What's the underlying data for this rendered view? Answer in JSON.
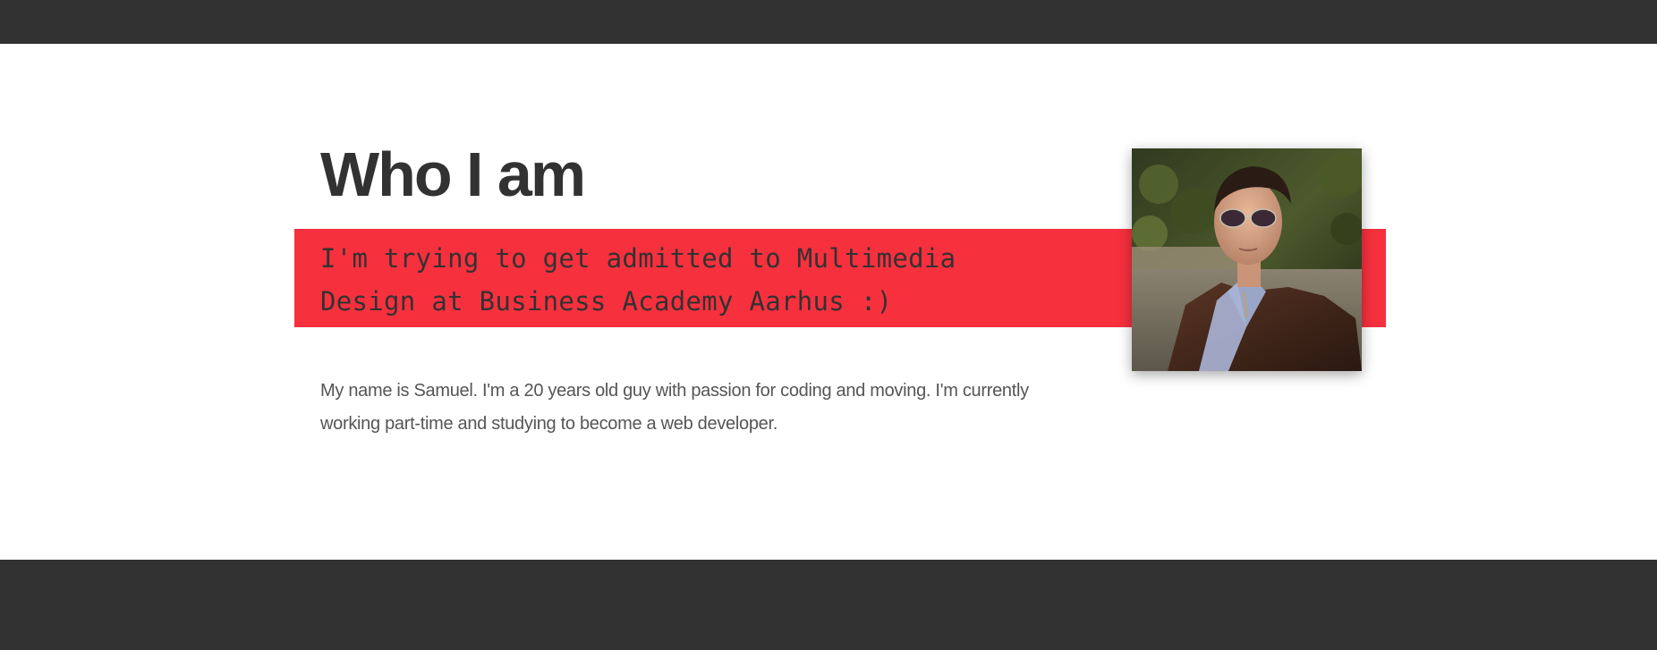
{
  "about": {
    "heading": "Who I am",
    "tagline": "I'm trying to get admitted to Multimedia Design at Business Academy Aarhus :)",
    "bio": "My name is Samuel. I'm a 20 years old guy with passion for coding and moving. I'm currently working part-time and studying to become a web developer.",
    "photo_icon": "portrait-photo"
  },
  "colors": {
    "dark_bar": "#323232",
    "accent_band": "#f7303e",
    "heading_text": "#323232",
    "body_text": "#555555",
    "background": "#ffffff"
  }
}
